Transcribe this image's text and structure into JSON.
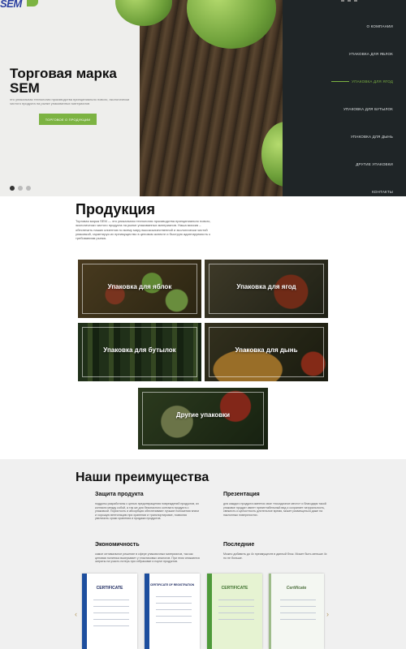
{
  "brand": {
    "logo_text": "SEM"
  },
  "hero": {
    "title": "Торговая марка SEM",
    "description": "это уникальная технология производства принципиально нового, экологически чистого продукта на рынке упакованных материалов",
    "button_label": "ТОРГОВОЕ О ПРОДУКЦИИ",
    "slides_total": 3,
    "active_slide": 1
  },
  "nav": {
    "items": [
      {
        "label": "О КОМПАНИИ",
        "active": false
      },
      {
        "label": "УПАКОВКА ДЛЯ ЯБЛОК",
        "active": false
      },
      {
        "label": "УПАКОВКА ДЛЯ ЯГОД",
        "active": true
      },
      {
        "label": "УПАКОВКА ДЛЯ БУТЫЛОК",
        "active": false
      },
      {
        "label": "УПАКОВКА ДЛЯ ДЫНЬ",
        "active": false
      },
      {
        "label": "ДРУГИЕ УПАКОВКИ",
        "active": false
      },
      {
        "label": "КОНТАКТЫ",
        "active": false
      }
    ],
    "accent_color": "#7cb342"
  },
  "products": {
    "title": "Продукция",
    "description": "Торговая марка SEM — это уникальная технология производства принципиально нового, экологически чистого продукта на рынке упакованных материалов. Наша миссия – обеспечить наших клиентов по всему миру высококачественной и экологически чистой упаковкой, гарантируя их преимущество в ценовом аспекте и быструю адаптируемость к требованиям рынка.",
    "cards": [
      {
        "label": "Упаковка для яблок"
      },
      {
        "label": "Упаковка для ягод"
      },
      {
        "label": "Упаковка для бутылок"
      },
      {
        "label": "Упаковка для дынь"
      },
      {
        "label": "Другие упаковки"
      }
    ]
  },
  "advantages": {
    "title": "Наши преимущества",
    "items": [
      {
        "heading": "Защита продукта",
        "text": "поддоны разработаны с целью предотвращения повреждений продуктов, их контакта между собой, а так же для безопасного контакта продукта с упаковкой. Пористость и абсорбция обеспечивают лучшие положения влаги и хорошую вентиляцию при хранении и транспортировке, позволяя увеличить сроки хранения и продажи продуктов."
      },
      {
        "heading": "Презентация",
        "text": "для каждого продукта имеется свое «посадочное место» и благодаря такой упаковке продукт имеет презентабельный вид и сохраняет натуральность, свежесть и целостность длительное время, может размещаться даже на наклонных поверхностях."
      },
      {
        "heading": "Экономичность",
        "text": "самое оптимальное решение в сфере упаковочных материалов, так как ценовая политика выигрывает у пластиковых аналогов. При этом снижаются затраты на участь потерь при отбраковке и порче продуктов."
      },
      {
        "heading": "Последние",
        "text": "Можно добавить до 4х преимуществ в данный блок. Может быть меньше 4х но не больше."
      }
    ],
    "certificates": [
      {
        "title": "CERTIFICATE"
      },
      {
        "title": "CERTIFICATE OF REGISTRATION"
      },
      {
        "title": "CERTIFICATE"
      },
      {
        "title": "Certificate"
      }
    ],
    "prev_glyph": "‹",
    "next_glyph": "›"
  }
}
